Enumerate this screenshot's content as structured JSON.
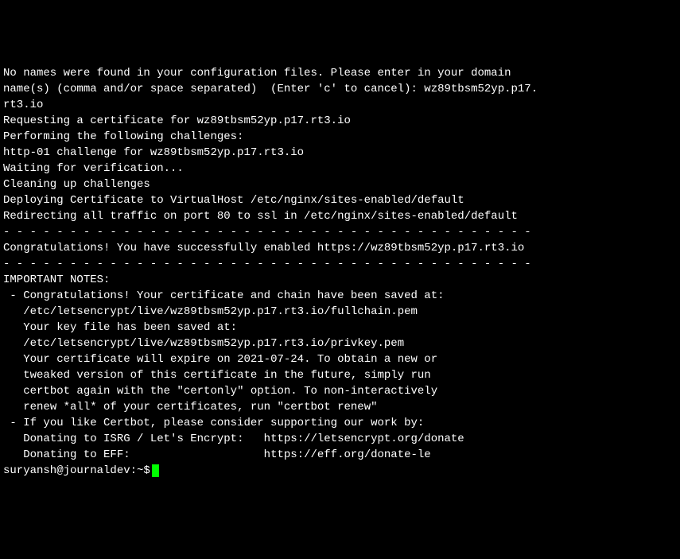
{
  "lines": [
    "No names were found in your configuration files. Please enter in your domain",
    "name(s) (comma and/or space separated)  (Enter 'c' to cancel): wz89tbsm52yp.p17.",
    "rt3.io",
    "Requesting a certificate for wz89tbsm52yp.p17.rt3.io",
    "Performing the following challenges:",
    "http-01 challenge for wz89tbsm52yp.p17.rt3.io",
    "Waiting for verification...",
    "Cleaning up challenges",
    "Deploying Certificate to VirtualHost /etc/nginx/sites-enabled/default",
    "Redirecting all traffic on port 80 to ssl in /etc/nginx/sites-enabled/default",
    "",
    "- - - - - - - - - - - - - - - - - - - - - - - - - - - - - - - - - - - - - - - -",
    "Congratulations! You have successfully enabled https://wz89tbsm52yp.p17.rt3.io",
    "- - - - - - - - - - - - - - - - - - - - - - - - - - - - - - - - - - - - - - - -",
    "",
    "",
    "",
    "",
    "IMPORTANT NOTES:",
    " - Congratulations! Your certificate and chain have been saved at:",
    "   /etc/letsencrypt/live/wz89tbsm52yp.p17.rt3.io/fullchain.pem",
    "   Your key file has been saved at:",
    "   /etc/letsencrypt/live/wz89tbsm52yp.p17.rt3.io/privkey.pem",
    "   Your certificate will expire on 2021-07-24. To obtain a new or",
    "   tweaked version of this certificate in the future, simply run",
    "   certbot again with the \"certonly\" option. To non-interactively",
    "   renew *all* of your certificates, run \"certbot renew\"",
    " - If you like Certbot, please consider supporting our work by:",
    "",
    "   Donating to ISRG / Let's Encrypt:   https://letsencrypt.org/donate",
    "   Donating to EFF:                    https://eff.org/donate-le",
    ""
  ],
  "prompt": "suryansh@journaldev:~$"
}
